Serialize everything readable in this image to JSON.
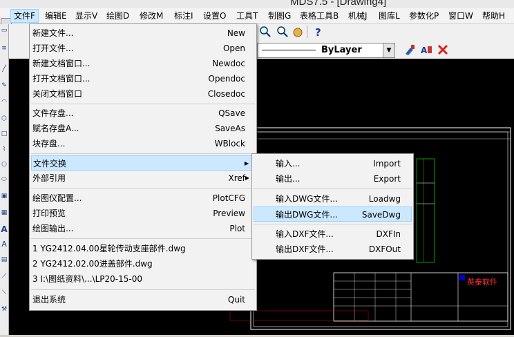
{
  "window": {
    "title": "MDS7.5 - [Drawing4]"
  },
  "menubar": [
    "文件F",
    "编辑E",
    "显示V",
    "绘图D",
    "修改M",
    "标注I",
    "设置O",
    "工具T",
    "制图G",
    "表格工具B",
    "机械J",
    "图库L",
    "参数化P",
    "窗口W",
    "帮助H"
  ],
  "toolbar": {
    "layer_value": "ByLayer"
  },
  "file_menu": {
    "items": [
      {
        "label": "新建文件...",
        "shortcut": "New"
      },
      {
        "label": "打开文件...",
        "shortcut": "Open"
      },
      {
        "label": "新建文档窗口...",
        "shortcut": "Newdoc"
      },
      {
        "label": "打开文档窗口...",
        "shortcut": "Opendoc"
      },
      {
        "label": "关闭文档窗口",
        "shortcut": "Closedoc"
      },
      {
        "label": "文件存盘...",
        "shortcut": "QSave"
      },
      {
        "label": "赋名存盘A...",
        "shortcut": "SaveAs"
      },
      {
        "label": "块存盘...",
        "shortcut": "WBlock"
      },
      {
        "label": "文件交换",
        "shortcut": ""
      },
      {
        "label": "外部引用",
        "shortcut": "Xref"
      },
      {
        "label": "绘图仪配置...",
        "shortcut": "PlotCFG"
      },
      {
        "label": "打印预览",
        "shortcut": "Preview"
      },
      {
        "label": "绘图输出...",
        "shortcut": "Plot"
      },
      {
        "label": "1 YG2412.04.00星轮传动支座部件.dwg",
        "shortcut": ""
      },
      {
        "label": "2 YG2412.02.00进盖部件.dwg",
        "shortcut": ""
      },
      {
        "label": "3 I:\\图纸资料\\...\\LP20-15-00",
        "shortcut": ""
      },
      {
        "label": "退出系统",
        "shortcut": "Quit"
      }
    ]
  },
  "exchange_menu": {
    "items": [
      {
        "label": "输入...",
        "shortcut": "Import"
      },
      {
        "label": "输出...",
        "shortcut": "Export"
      },
      {
        "label": "输入DWG文件...",
        "shortcut": "Loadwg"
      },
      {
        "label": "输出DWG文件...",
        "shortcut": "SaveDwg"
      },
      {
        "label": "输入DXF文件...",
        "shortcut": "DXFIn"
      },
      {
        "label": "输出DXF文件...",
        "shortcut": "DXFOut"
      }
    ]
  },
  "drawing": {
    "company": "英泰软件"
  },
  "colors": {
    "highlight": "#cce8ff",
    "highlight_border": "#99d1ff",
    "canvas": "#000000",
    "drawing_line": "#ffffff",
    "dim_line": "#00c800",
    "border_red": "#c00000"
  }
}
